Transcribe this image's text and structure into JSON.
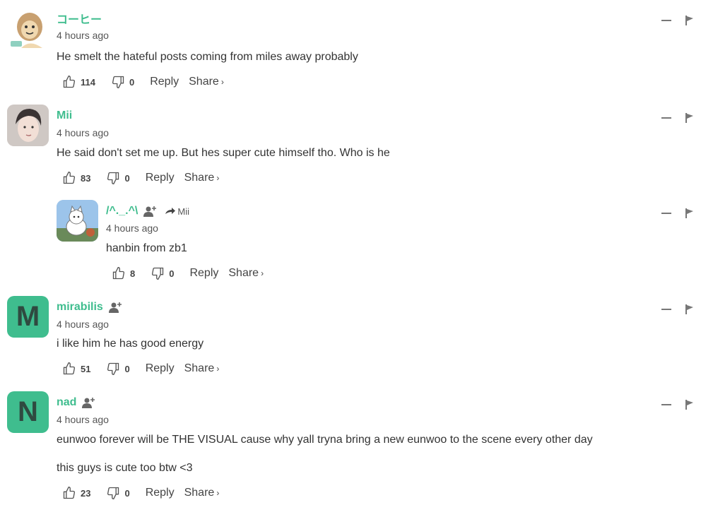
{
  "comments": [
    {
      "name": "コーヒー",
      "time": "4 hours ago",
      "lines": [
        "He smelt the hateful posts coming from miles away probably"
      ],
      "likes": "114",
      "dislikes": "0",
      "reply_label": "Reply",
      "share_label": "Share"
    },
    {
      "name": "Mii",
      "time": "4 hours ago",
      "lines": [
        "He said don't set me up. But hes super cute himself tho. Who is he"
      ],
      "likes": "83",
      "dislikes": "0",
      "reply_label": "Reply",
      "share_label": "Share"
    },
    {
      "name": "/^._.^\\",
      "reply_to": "Mii",
      "time": "4 hours ago",
      "lines": [
        "hanbin from zb1"
      ],
      "likes": "8",
      "dislikes": "0",
      "reply_label": "Reply",
      "share_label": "Share"
    },
    {
      "name": "mirabilis",
      "avatar_letter": "M",
      "time": "4 hours ago",
      "lines": [
        "i like him he has good energy"
      ],
      "likes": "51",
      "dislikes": "0",
      "reply_label": "Reply",
      "share_label": "Share"
    },
    {
      "name": "nad",
      "avatar_letter": "N",
      "time": "4 hours ago",
      "lines": [
        "eunwoo forever will be THE VISUAL cause why yall tryna bring a new eunwoo to the scene every other day",
        "this guys is cute too btw <3"
      ],
      "likes": "23",
      "dislikes": "0",
      "reply_label": "Reply",
      "share_label": "Share"
    }
  ],
  "colors": {
    "accent": "#3fbd8e",
    "text": "#333333",
    "muted": "#555555"
  },
  "icons": [
    "thumbs-up-icon",
    "thumbs-down-icon",
    "follow-user-icon",
    "minimize-icon",
    "flag-icon",
    "reply-arrow-icon"
  ]
}
